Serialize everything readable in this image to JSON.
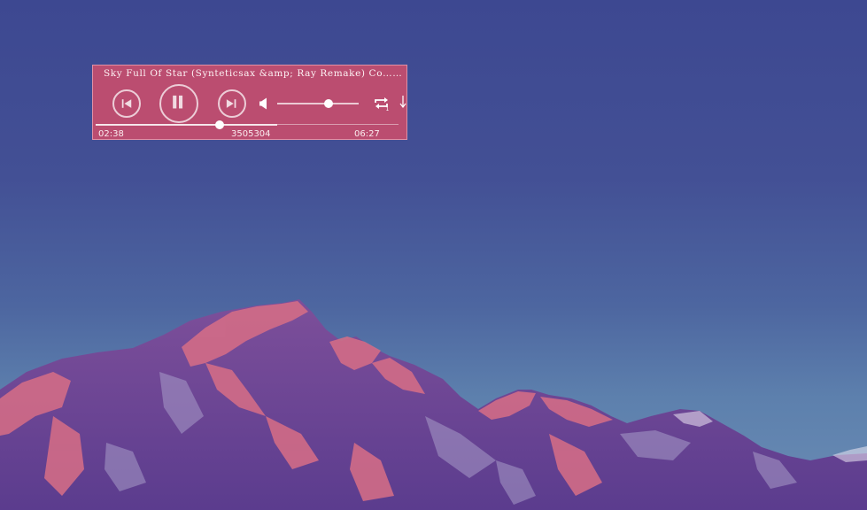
{
  "player": {
    "song_title": "Sky Full Of Star (Synteticsax &amp; Ray Remake) Coldplay",
    "current_time": "02:38",
    "track_id": "3505304",
    "total_time": "06:27",
    "progress": 0.41,
    "buffered": 0.6,
    "volume": 0.63,
    "state": "playing",
    "icons": {
      "prev": "skip-previous-icon",
      "play_pause": "pause-icon",
      "next": "skip-next-icon",
      "volume": "speaker-icon",
      "repeat": "repeat-one-icon",
      "download": "download-arrow-icon"
    }
  },
  "colors": {
    "player_background": "#c54e6e",
    "sky_top": "#3d4891",
    "sky_bottom": "#6a8cb4"
  }
}
